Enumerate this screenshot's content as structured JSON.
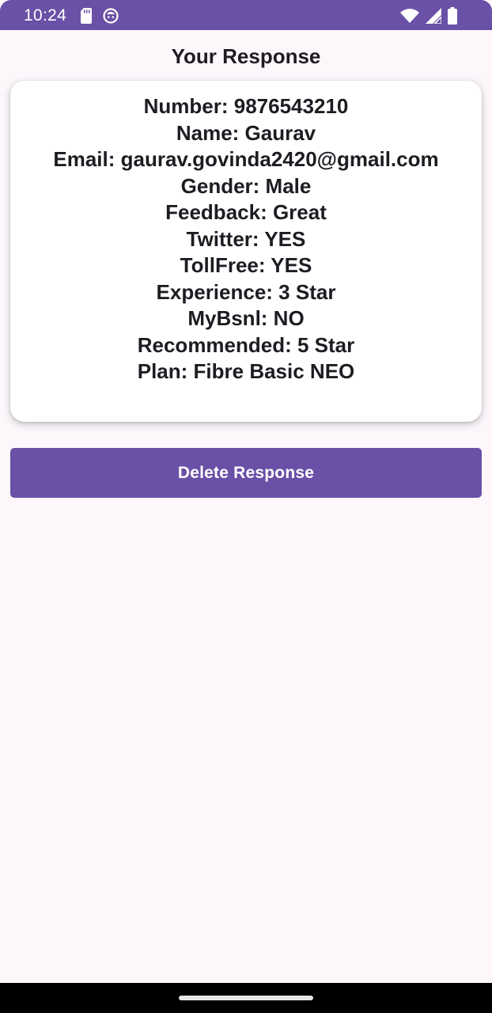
{
  "status_bar": {
    "time": "10:24",
    "icons_left": [
      "sd-card-icon",
      "cat-face-icon"
    ],
    "icons_right": [
      "wifi-icon",
      "cellular-signal-icon",
      "battery-icon"
    ],
    "background_color": "#6a50a6"
  },
  "page": {
    "title": "Your Response",
    "background_color": "#fdf7fc"
  },
  "response": {
    "lines": [
      "Number: 9876543210",
      "Name: Gaurav",
      "Email: gaurav.govinda2420@gmail.com",
      "Gender: Male",
      "Feedback: Great",
      "Twitter: YES",
      "TollFree: YES",
      "Experience: 3 Star",
      "MyBsnl: NO",
      "Recommended: 5 Star",
      "Plan: Fibre Basic NEO"
    ]
  },
  "actions": {
    "delete_label": "Delete Response",
    "accent_color": "#6a50a6"
  }
}
